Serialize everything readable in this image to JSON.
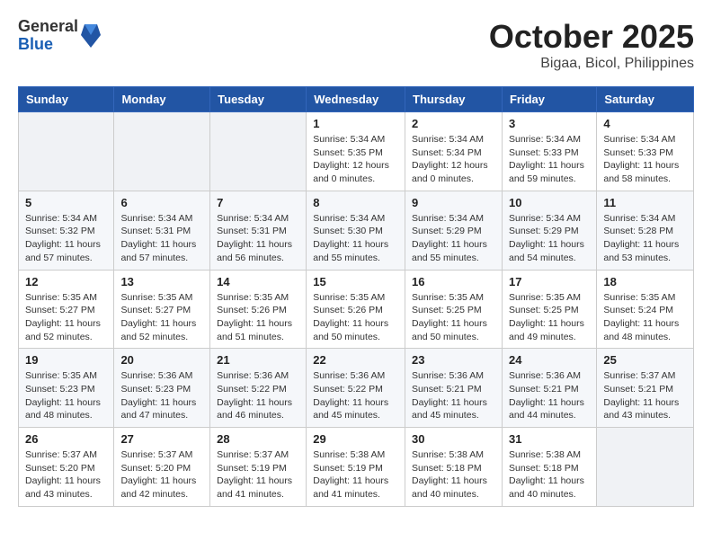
{
  "logo": {
    "general": "General",
    "blue": "Blue"
  },
  "header": {
    "month": "October 2025",
    "location": "Bigaa, Bicol, Philippines"
  },
  "weekdays": [
    "Sunday",
    "Monday",
    "Tuesday",
    "Wednesday",
    "Thursday",
    "Friday",
    "Saturday"
  ],
  "weeks": [
    [
      {
        "day": "",
        "sunrise": "",
        "sunset": "",
        "daylight": ""
      },
      {
        "day": "",
        "sunrise": "",
        "sunset": "",
        "daylight": ""
      },
      {
        "day": "",
        "sunrise": "",
        "sunset": "",
        "daylight": ""
      },
      {
        "day": "1",
        "sunrise": "Sunrise: 5:34 AM",
        "sunset": "Sunset: 5:35 PM",
        "daylight": "Daylight: 12 hours and 0 minutes."
      },
      {
        "day": "2",
        "sunrise": "Sunrise: 5:34 AM",
        "sunset": "Sunset: 5:34 PM",
        "daylight": "Daylight: 12 hours and 0 minutes."
      },
      {
        "day": "3",
        "sunrise": "Sunrise: 5:34 AM",
        "sunset": "Sunset: 5:33 PM",
        "daylight": "Daylight: 11 hours and 59 minutes."
      },
      {
        "day": "4",
        "sunrise": "Sunrise: 5:34 AM",
        "sunset": "Sunset: 5:33 PM",
        "daylight": "Daylight: 11 hours and 58 minutes."
      }
    ],
    [
      {
        "day": "5",
        "sunrise": "Sunrise: 5:34 AM",
        "sunset": "Sunset: 5:32 PM",
        "daylight": "Daylight: 11 hours and 57 minutes."
      },
      {
        "day": "6",
        "sunrise": "Sunrise: 5:34 AM",
        "sunset": "Sunset: 5:31 PM",
        "daylight": "Daylight: 11 hours and 57 minutes."
      },
      {
        "day": "7",
        "sunrise": "Sunrise: 5:34 AM",
        "sunset": "Sunset: 5:31 PM",
        "daylight": "Daylight: 11 hours and 56 minutes."
      },
      {
        "day": "8",
        "sunrise": "Sunrise: 5:34 AM",
        "sunset": "Sunset: 5:30 PM",
        "daylight": "Daylight: 11 hours and 55 minutes."
      },
      {
        "day": "9",
        "sunrise": "Sunrise: 5:34 AM",
        "sunset": "Sunset: 5:29 PM",
        "daylight": "Daylight: 11 hours and 55 minutes."
      },
      {
        "day": "10",
        "sunrise": "Sunrise: 5:34 AM",
        "sunset": "Sunset: 5:29 PM",
        "daylight": "Daylight: 11 hours and 54 minutes."
      },
      {
        "day": "11",
        "sunrise": "Sunrise: 5:34 AM",
        "sunset": "Sunset: 5:28 PM",
        "daylight": "Daylight: 11 hours and 53 minutes."
      }
    ],
    [
      {
        "day": "12",
        "sunrise": "Sunrise: 5:35 AM",
        "sunset": "Sunset: 5:27 PM",
        "daylight": "Daylight: 11 hours and 52 minutes."
      },
      {
        "day": "13",
        "sunrise": "Sunrise: 5:35 AM",
        "sunset": "Sunset: 5:27 PM",
        "daylight": "Daylight: 11 hours and 52 minutes."
      },
      {
        "day": "14",
        "sunrise": "Sunrise: 5:35 AM",
        "sunset": "Sunset: 5:26 PM",
        "daylight": "Daylight: 11 hours and 51 minutes."
      },
      {
        "day": "15",
        "sunrise": "Sunrise: 5:35 AM",
        "sunset": "Sunset: 5:26 PM",
        "daylight": "Daylight: 11 hours and 50 minutes."
      },
      {
        "day": "16",
        "sunrise": "Sunrise: 5:35 AM",
        "sunset": "Sunset: 5:25 PM",
        "daylight": "Daylight: 11 hours and 50 minutes."
      },
      {
        "day": "17",
        "sunrise": "Sunrise: 5:35 AM",
        "sunset": "Sunset: 5:25 PM",
        "daylight": "Daylight: 11 hours and 49 minutes."
      },
      {
        "day": "18",
        "sunrise": "Sunrise: 5:35 AM",
        "sunset": "Sunset: 5:24 PM",
        "daylight": "Daylight: 11 hours and 48 minutes."
      }
    ],
    [
      {
        "day": "19",
        "sunrise": "Sunrise: 5:35 AM",
        "sunset": "Sunset: 5:23 PM",
        "daylight": "Daylight: 11 hours and 48 minutes."
      },
      {
        "day": "20",
        "sunrise": "Sunrise: 5:36 AM",
        "sunset": "Sunset: 5:23 PM",
        "daylight": "Daylight: 11 hours and 47 minutes."
      },
      {
        "day": "21",
        "sunrise": "Sunrise: 5:36 AM",
        "sunset": "Sunset: 5:22 PM",
        "daylight": "Daylight: 11 hours and 46 minutes."
      },
      {
        "day": "22",
        "sunrise": "Sunrise: 5:36 AM",
        "sunset": "Sunset: 5:22 PM",
        "daylight": "Daylight: 11 hours and 45 minutes."
      },
      {
        "day": "23",
        "sunrise": "Sunrise: 5:36 AM",
        "sunset": "Sunset: 5:21 PM",
        "daylight": "Daylight: 11 hours and 45 minutes."
      },
      {
        "day": "24",
        "sunrise": "Sunrise: 5:36 AM",
        "sunset": "Sunset: 5:21 PM",
        "daylight": "Daylight: 11 hours and 44 minutes."
      },
      {
        "day": "25",
        "sunrise": "Sunrise: 5:37 AM",
        "sunset": "Sunset: 5:21 PM",
        "daylight": "Daylight: 11 hours and 43 minutes."
      }
    ],
    [
      {
        "day": "26",
        "sunrise": "Sunrise: 5:37 AM",
        "sunset": "Sunset: 5:20 PM",
        "daylight": "Daylight: 11 hours and 43 minutes."
      },
      {
        "day": "27",
        "sunrise": "Sunrise: 5:37 AM",
        "sunset": "Sunset: 5:20 PM",
        "daylight": "Daylight: 11 hours and 42 minutes."
      },
      {
        "day": "28",
        "sunrise": "Sunrise: 5:37 AM",
        "sunset": "Sunset: 5:19 PM",
        "daylight": "Daylight: 11 hours and 41 minutes."
      },
      {
        "day": "29",
        "sunrise": "Sunrise: 5:38 AM",
        "sunset": "Sunset: 5:19 PM",
        "daylight": "Daylight: 11 hours and 41 minutes."
      },
      {
        "day": "30",
        "sunrise": "Sunrise: 5:38 AM",
        "sunset": "Sunset: 5:18 PM",
        "daylight": "Daylight: 11 hours and 40 minutes."
      },
      {
        "day": "31",
        "sunrise": "Sunrise: 5:38 AM",
        "sunset": "Sunset: 5:18 PM",
        "daylight": "Daylight: 11 hours and 40 minutes."
      },
      {
        "day": "",
        "sunrise": "",
        "sunset": "",
        "daylight": ""
      }
    ]
  ]
}
